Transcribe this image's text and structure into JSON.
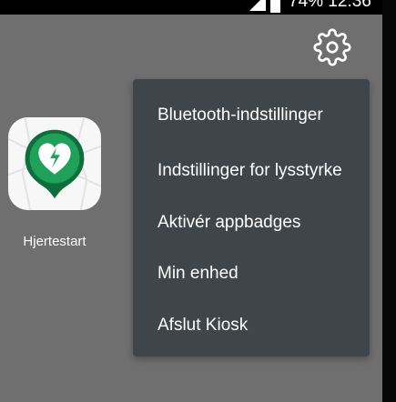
{
  "status_bar": {
    "text": "74% 12:36",
    "icons": [
      "signal-icon",
      "battery-icon"
    ]
  },
  "settings": {
    "icon": "gear-icon"
  },
  "app": {
    "label": "Hjertestart",
    "icon": "heart-defibrillator-pin-icon",
    "colors": {
      "accent": "#1fa15a",
      "dark_accent": "#0f6e3c",
      "heart": "#ffffff",
      "bolt": "#1fa15a"
    }
  },
  "menu": {
    "items": [
      {
        "label": "Bluetooth-indstillinger"
      },
      {
        "label": "Indstillinger for lysstyrke"
      },
      {
        "label": "Aktivér appbadges"
      },
      {
        "label": "Min enhed"
      },
      {
        "label": "Afslut Kiosk"
      }
    ]
  },
  "colors": {
    "background": "#6f6f6f",
    "menu_background": "#3f4548",
    "text": "#ffffff",
    "status_bar": "#000000"
  }
}
